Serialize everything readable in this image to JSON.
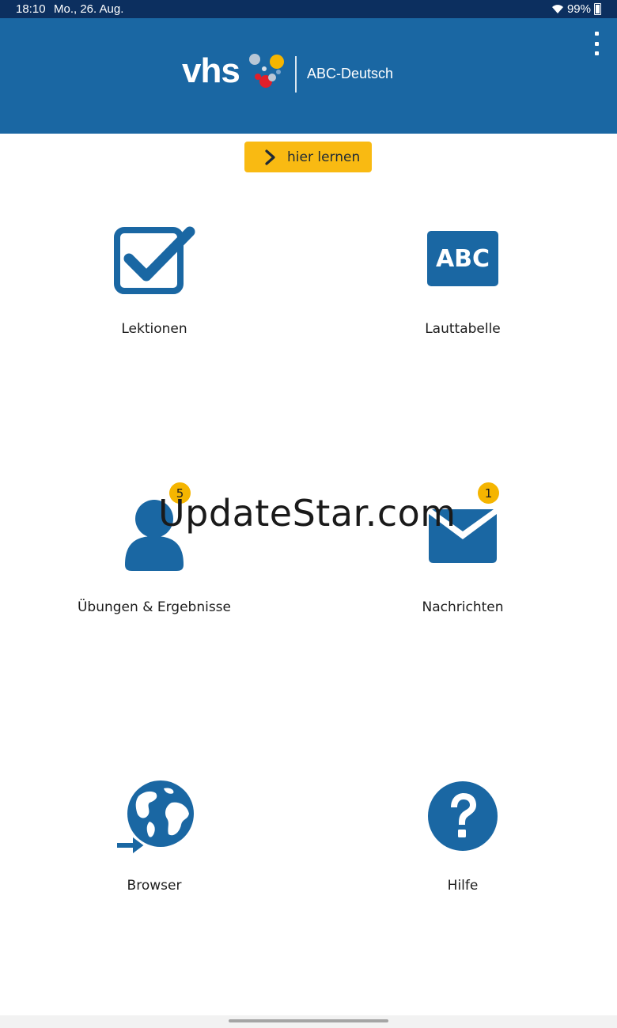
{
  "status_bar": {
    "time": "18:10",
    "date": "Mo., 26. Aug.",
    "battery": "99%"
  },
  "header": {
    "logo_text": "vhs",
    "app_title": "ABC-Deutsch",
    "icons": [
      "menu-icon"
    ]
  },
  "learn_button": {
    "label": "hier lernen",
    "icon": "chevron-right-icon"
  },
  "tiles": [
    {
      "label": "Lektionen",
      "icon": "checkbox-icon"
    },
    {
      "label": "Lauttabelle",
      "icon": "abc-icon",
      "icon_text": "ABC"
    },
    {
      "label": "Übungen & Ergebnisse",
      "icon": "user-icon",
      "badge": "5"
    },
    {
      "label": "Nachrichten",
      "icon": "mail-icon",
      "badge": "1"
    },
    {
      "label": "Browser",
      "icon": "globe-icon"
    },
    {
      "label": "Hilfe",
      "icon": "help-icon"
    }
  ],
  "watermark": "UpdateStar.com",
  "colors": {
    "status_bar": "#0c2f5f",
    "header": "#1a67a3",
    "icon_blue": "#1a67a3",
    "accent_yellow": "#f9ba12",
    "badge_yellow": "#f5b500"
  }
}
